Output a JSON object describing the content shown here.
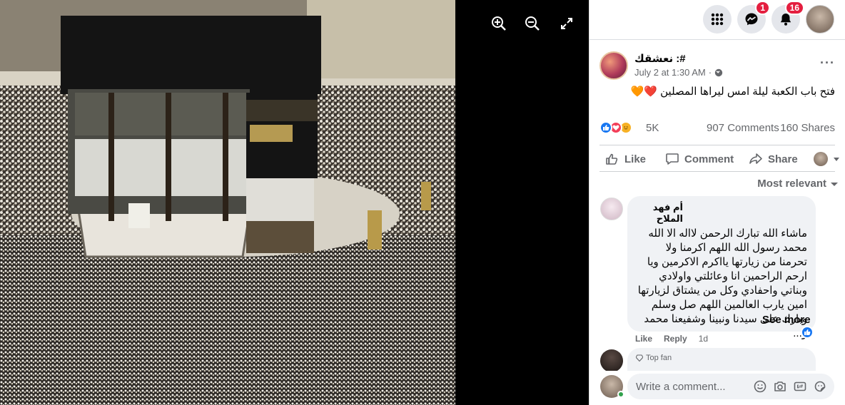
{
  "viewer": {
    "zoom_in_icon": "zoom-in-icon",
    "zoom_out_icon": "zoom-out-icon",
    "fullscreen_icon": "fullscreen-icon"
  },
  "topbar": {
    "menu_icon": "grid-menu-icon",
    "messenger_badge": "1",
    "notifications_badge": "16"
  },
  "post": {
    "page_name": "نعشقك :#",
    "timestamp": "July 2 at 1:30 AM",
    "separator": "·",
    "caption": "فتح باب الكعبة ليلة امس ليراها المصلين ❤️🧡",
    "reactions_count": "5K",
    "comments_count": "907 Comments",
    "shares_count": "160 Shares"
  },
  "actions": {
    "like_label": "Like",
    "comment_label": "Comment",
    "share_label": "Share"
  },
  "comments_section": {
    "sort_label": "Most relevant",
    "comment1": {
      "author": "أم فهد الملاح",
      "text": "ماشاء الله تبارك الرحمن لااله الا الله محمد رسول الله اللهم اكرمنا ولا تحرمنا من زيارتها يااكرم الاكرمين ويا ارحم الراحمين انا وعائلتي واولادي وبناتي واحفادي وكل من يشتاق لزيارتها امين يارب العالمين اللهم صل وسلم وبارك على سيدنا ونبينا وشفيعنا محمد و...",
      "see_more": "See more",
      "like": "Like",
      "reply": "Reply",
      "time": "1d"
    },
    "comment2": {
      "badge": "Top fan"
    },
    "write_placeholder": "Write a comment..."
  },
  "colors": {
    "accent": "#1877f2",
    "badge": "#e41e3f",
    "love": "#f33e58",
    "care": "#f7b125"
  }
}
